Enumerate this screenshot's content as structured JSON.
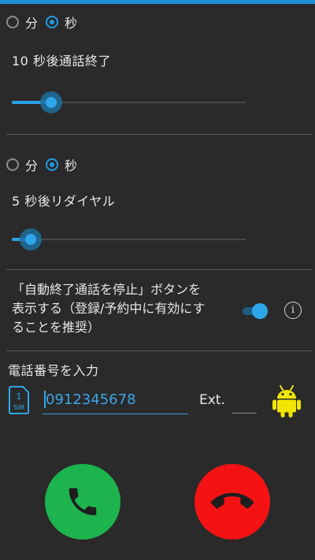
{
  "section1": {
    "unit_options": [
      "分",
      "秒"
    ],
    "selected_unit": "秒",
    "label": "10 秒後通話終了",
    "slider_fraction": 0.17
  },
  "section2": {
    "unit_options": [
      "分",
      "秒"
    ],
    "selected_unit": "秒",
    "label": "5 秒後リダイヤル",
    "slider_fraction": 0.08
  },
  "stop_button_setting": {
    "description_lines": [
      "「自動終了通話を停止」ボタンを",
      "表示する（登録/予約中に有効にす",
      "ることを推奨）"
    ],
    "toggle_on": true,
    "info_icon": "info-icon"
  },
  "phone": {
    "title": "電話番号を入力",
    "sim_label_number": "1",
    "sim_label_text": "SIM",
    "number_value": "0912345678",
    "ext_label": "Ext.",
    "ext_value": ""
  },
  "colors": {
    "accent": "#2ea6ea",
    "call": "#1db44d",
    "end": "#f51212",
    "background": "#2a2a2a"
  }
}
